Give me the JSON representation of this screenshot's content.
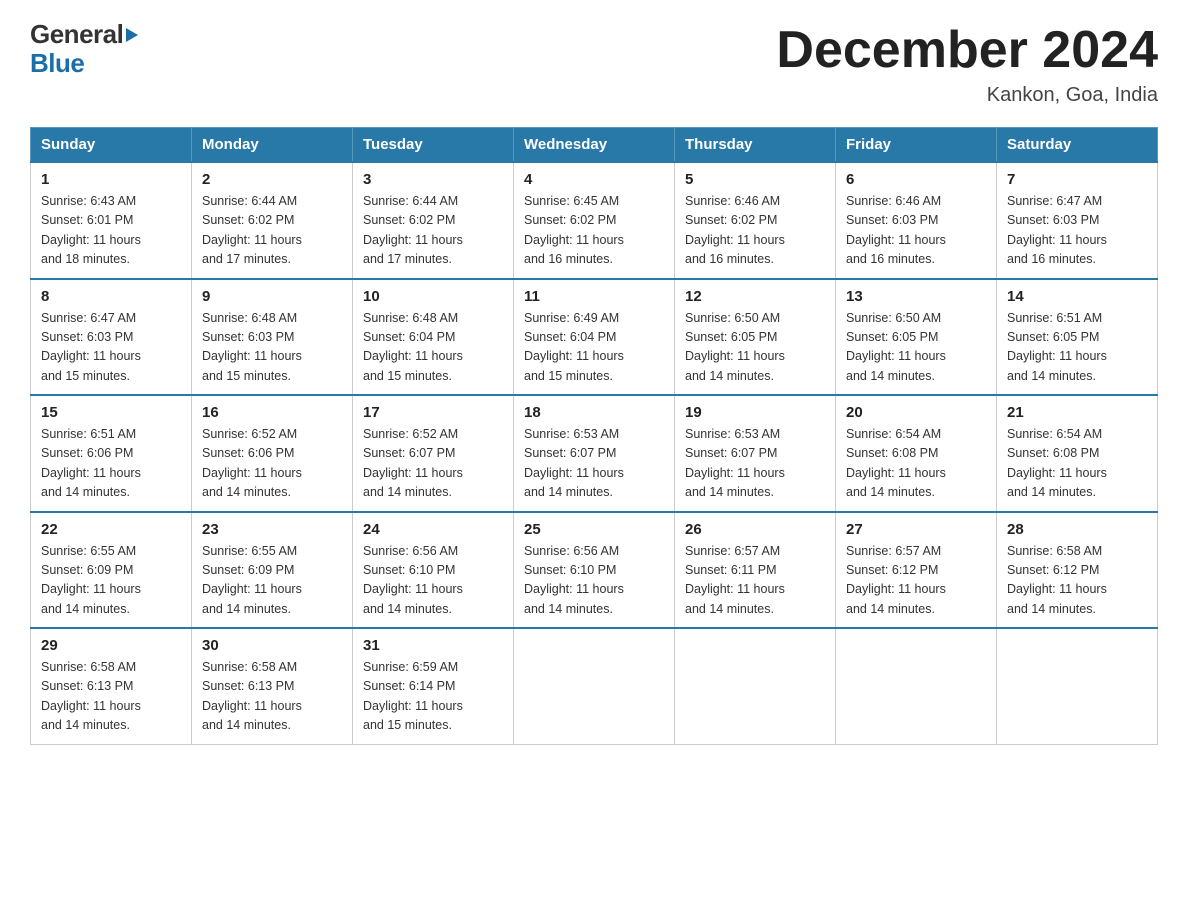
{
  "header": {
    "logo_general": "General",
    "logo_blue": "Blue",
    "month_title": "December 2024",
    "location": "Kankon, Goa, India"
  },
  "days_of_week": [
    "Sunday",
    "Monday",
    "Tuesday",
    "Wednesday",
    "Thursday",
    "Friday",
    "Saturday"
  ],
  "weeks": [
    [
      {
        "day": "1",
        "sunrise": "6:43 AM",
        "sunset": "6:01 PM",
        "daylight": "11 hours and 18 minutes."
      },
      {
        "day": "2",
        "sunrise": "6:44 AM",
        "sunset": "6:02 PM",
        "daylight": "11 hours and 17 minutes."
      },
      {
        "day": "3",
        "sunrise": "6:44 AM",
        "sunset": "6:02 PM",
        "daylight": "11 hours and 17 minutes."
      },
      {
        "day": "4",
        "sunrise": "6:45 AM",
        "sunset": "6:02 PM",
        "daylight": "11 hours and 16 minutes."
      },
      {
        "day": "5",
        "sunrise": "6:46 AM",
        "sunset": "6:02 PM",
        "daylight": "11 hours and 16 minutes."
      },
      {
        "day": "6",
        "sunrise": "6:46 AM",
        "sunset": "6:03 PM",
        "daylight": "11 hours and 16 minutes."
      },
      {
        "day": "7",
        "sunrise": "6:47 AM",
        "sunset": "6:03 PM",
        "daylight": "11 hours and 16 minutes."
      }
    ],
    [
      {
        "day": "8",
        "sunrise": "6:47 AM",
        "sunset": "6:03 PM",
        "daylight": "11 hours and 15 minutes."
      },
      {
        "day": "9",
        "sunrise": "6:48 AM",
        "sunset": "6:03 PM",
        "daylight": "11 hours and 15 minutes."
      },
      {
        "day": "10",
        "sunrise": "6:48 AM",
        "sunset": "6:04 PM",
        "daylight": "11 hours and 15 minutes."
      },
      {
        "day": "11",
        "sunrise": "6:49 AM",
        "sunset": "6:04 PM",
        "daylight": "11 hours and 15 minutes."
      },
      {
        "day": "12",
        "sunrise": "6:50 AM",
        "sunset": "6:05 PM",
        "daylight": "11 hours and 14 minutes."
      },
      {
        "day": "13",
        "sunrise": "6:50 AM",
        "sunset": "6:05 PM",
        "daylight": "11 hours and 14 minutes."
      },
      {
        "day": "14",
        "sunrise": "6:51 AM",
        "sunset": "6:05 PM",
        "daylight": "11 hours and 14 minutes."
      }
    ],
    [
      {
        "day": "15",
        "sunrise": "6:51 AM",
        "sunset": "6:06 PM",
        "daylight": "11 hours and 14 minutes."
      },
      {
        "day": "16",
        "sunrise": "6:52 AM",
        "sunset": "6:06 PM",
        "daylight": "11 hours and 14 minutes."
      },
      {
        "day": "17",
        "sunrise": "6:52 AM",
        "sunset": "6:07 PM",
        "daylight": "11 hours and 14 minutes."
      },
      {
        "day": "18",
        "sunrise": "6:53 AM",
        "sunset": "6:07 PM",
        "daylight": "11 hours and 14 minutes."
      },
      {
        "day": "19",
        "sunrise": "6:53 AM",
        "sunset": "6:07 PM",
        "daylight": "11 hours and 14 minutes."
      },
      {
        "day": "20",
        "sunrise": "6:54 AM",
        "sunset": "6:08 PM",
        "daylight": "11 hours and 14 minutes."
      },
      {
        "day": "21",
        "sunrise": "6:54 AM",
        "sunset": "6:08 PM",
        "daylight": "11 hours and 14 minutes."
      }
    ],
    [
      {
        "day": "22",
        "sunrise": "6:55 AM",
        "sunset": "6:09 PM",
        "daylight": "11 hours and 14 minutes."
      },
      {
        "day": "23",
        "sunrise": "6:55 AM",
        "sunset": "6:09 PM",
        "daylight": "11 hours and 14 minutes."
      },
      {
        "day": "24",
        "sunrise": "6:56 AM",
        "sunset": "6:10 PM",
        "daylight": "11 hours and 14 minutes."
      },
      {
        "day": "25",
        "sunrise": "6:56 AM",
        "sunset": "6:10 PM",
        "daylight": "11 hours and 14 minutes."
      },
      {
        "day": "26",
        "sunrise": "6:57 AM",
        "sunset": "6:11 PM",
        "daylight": "11 hours and 14 minutes."
      },
      {
        "day": "27",
        "sunrise": "6:57 AM",
        "sunset": "6:12 PM",
        "daylight": "11 hours and 14 minutes."
      },
      {
        "day": "28",
        "sunrise": "6:58 AM",
        "sunset": "6:12 PM",
        "daylight": "11 hours and 14 minutes."
      }
    ],
    [
      {
        "day": "29",
        "sunrise": "6:58 AM",
        "sunset": "6:13 PM",
        "daylight": "11 hours and 14 minutes."
      },
      {
        "day": "30",
        "sunrise": "6:58 AM",
        "sunset": "6:13 PM",
        "daylight": "11 hours and 14 minutes."
      },
      {
        "day": "31",
        "sunrise": "6:59 AM",
        "sunset": "6:14 PM",
        "daylight": "11 hours and 15 minutes."
      },
      null,
      null,
      null,
      null
    ]
  ],
  "labels": {
    "sunrise": "Sunrise:",
    "sunset": "Sunset:",
    "daylight": "Daylight:"
  }
}
